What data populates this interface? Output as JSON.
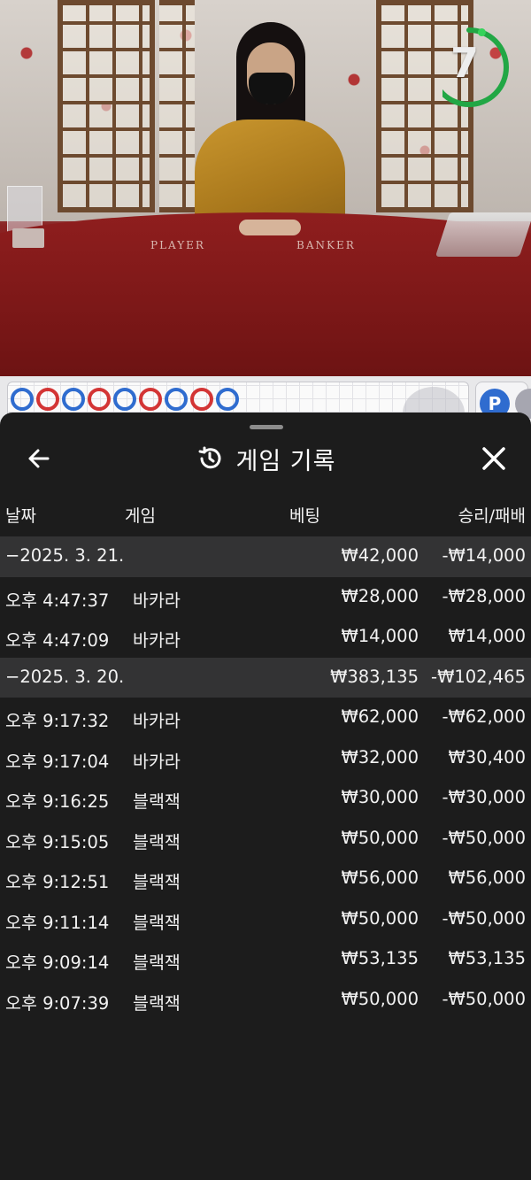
{
  "video": {
    "table_labels": {
      "player": "PLAYER",
      "banker": "BANKER"
    },
    "timer": {
      "value": "7",
      "progress_fraction": 0.75,
      "color": "#22a745"
    }
  },
  "roadmap": {
    "beads": [
      "b",
      "r",
      "b",
      "r",
      "b",
      "r",
      "b",
      "r",
      "b"
    ],
    "colors": {
      "banker": "#d33535",
      "player": "#2f6ccf"
    },
    "toggle_label": "P"
  },
  "sheet": {
    "title": "게임 기록",
    "title_icon": "history-icon",
    "back_icon": "arrow-left-icon",
    "close_icon": "close-icon",
    "columns": {
      "date": "날짜",
      "game": "게임",
      "bet": "베팅",
      "result": "승리/패배"
    },
    "groups": [
      {
        "date": "−2025. 3. 21.",
        "bet": "₩42,000",
        "result": "-₩14,000",
        "rows": [
          {
            "time": "오후 4:47:37",
            "game": "바카라",
            "bet": "₩28,000",
            "result": "-₩28,000"
          },
          {
            "time": "오후 4:47:09",
            "game": "바카라",
            "bet": "₩14,000",
            "result": "₩14,000"
          }
        ]
      },
      {
        "date": "−2025. 3. 20.",
        "bet": "₩383,135",
        "result": "-₩102,465",
        "rows": [
          {
            "time": "오후 9:17:32",
            "game": "바카라",
            "bet": "₩62,000",
            "result": "-₩62,000"
          },
          {
            "time": "오후 9:17:04",
            "game": "바카라",
            "bet": "₩32,000",
            "result": "₩30,400"
          },
          {
            "time": "오후 9:16:25",
            "game": "블랙잭",
            "bet": "₩30,000",
            "result": "-₩30,000"
          },
          {
            "time": "오후 9:15:05",
            "game": "블랙잭",
            "bet": "₩50,000",
            "result": "-₩50,000"
          },
          {
            "time": "오후 9:12:51",
            "game": "블랙잭",
            "bet": "₩56,000",
            "result": "₩56,000"
          },
          {
            "time": "오후 9:11:14",
            "game": "블랙잭",
            "bet": "₩50,000",
            "result": "-₩50,000"
          },
          {
            "time": "오후 9:09:14",
            "game": "블랙잭",
            "bet": "₩53,135",
            "result": "₩53,135"
          },
          {
            "time": "오후 9:07:39",
            "game": "블랙잭",
            "bet": "₩50,000",
            "result": "-₩50,000"
          }
        ]
      }
    ]
  }
}
